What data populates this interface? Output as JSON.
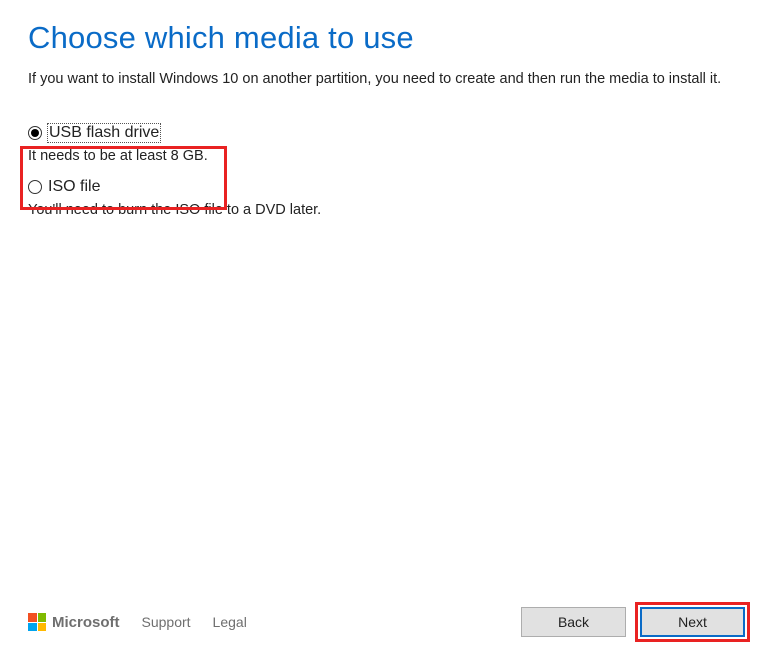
{
  "page": {
    "title": "Choose which media to use",
    "subtitle": "If you want to install Windows 10 on another partition, you need to create and then run the media to install it."
  },
  "options": [
    {
      "label": "USB flash drive",
      "description": "It needs to be at least 8 GB.",
      "selected": true
    },
    {
      "label": "ISO file",
      "description": "You'll need to burn the ISO file to a DVD later.",
      "selected": false
    }
  ],
  "footer": {
    "brand": "Microsoft",
    "links": {
      "support": "Support",
      "legal": "Legal"
    },
    "buttons": {
      "back": "Back",
      "next": "Next"
    }
  }
}
